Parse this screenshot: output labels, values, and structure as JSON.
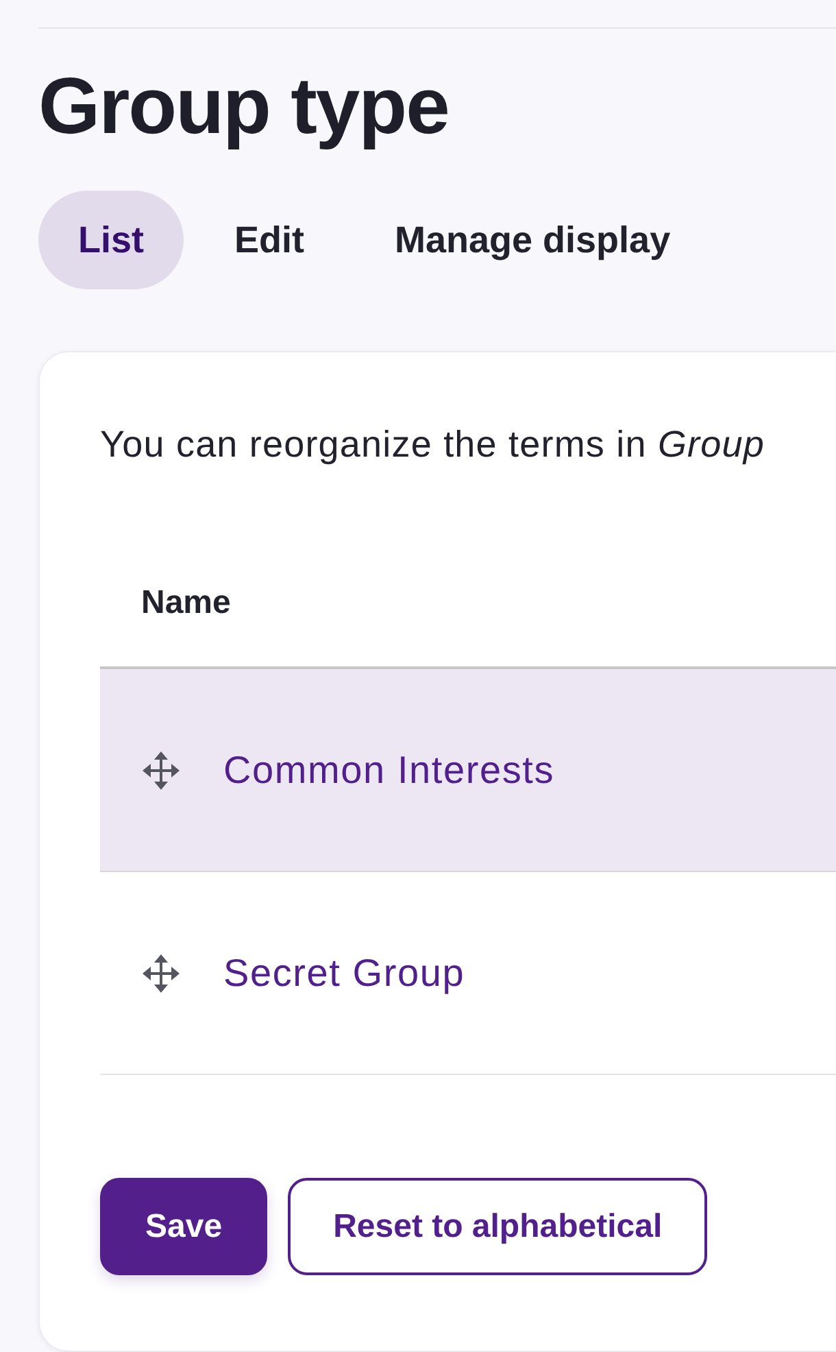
{
  "page": {
    "title": "Group type"
  },
  "tabs": [
    {
      "label": "List",
      "selected": true
    },
    {
      "label": "Edit",
      "selected": false
    },
    {
      "label": "Manage display",
      "selected": false
    }
  ],
  "card": {
    "description": "You can reorganize the terms in *Group*",
    "table": {
      "columns": [
        "Name"
      ],
      "rows": [
        {
          "name": "Common Interests",
          "highlighted": true
        },
        {
          "name": "Secret Group",
          "highlighted": false
        }
      ]
    },
    "buttons": [
      {
        "label": "Save",
        "kind": "primary"
      },
      {
        "label": "Reset to alphabetical",
        "kind": "secondary"
      }
    ]
  }
}
